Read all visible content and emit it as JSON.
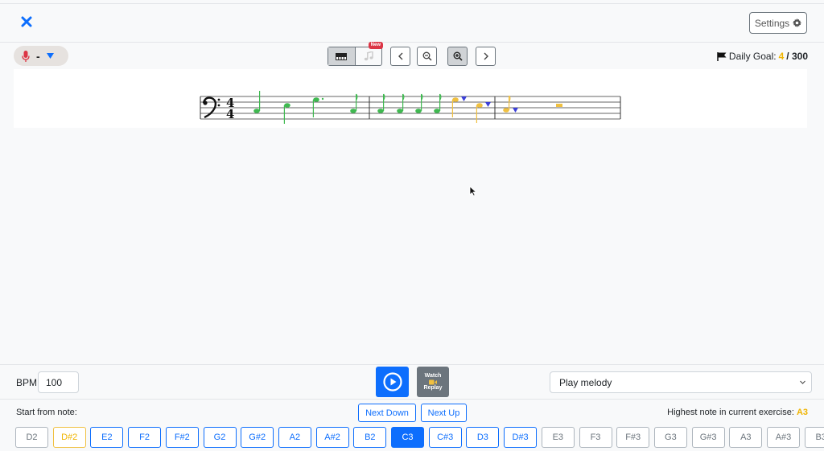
{
  "toolbar": {
    "settings_label": "Settings",
    "mic_value": "-",
    "new_badge": "New",
    "daily_goal_label": "Daily Goal:",
    "daily_goal_current": "4",
    "daily_goal_total": "/ 300"
  },
  "colors": {
    "accent": "#0d6efd",
    "correct": "#3fb950",
    "partial": "#f0c040",
    "marker": "#3b3fd8",
    "mic": "#dc3545"
  },
  "controls": {
    "bpm_label": "BPM",
    "bpm_value": "100",
    "watch_line1": "Watch",
    "watch_line2": "Replay",
    "mode_value": "Play melody"
  },
  "notes_section": {
    "start_label": "Start from note:",
    "next_down": "Next Down",
    "next_up": "Next Up",
    "highest_label": "Highest note in current exercise:",
    "highest_value": "A3",
    "notes": [
      {
        "label": "D2",
        "state": "default"
      },
      {
        "label": "D#2",
        "state": "lowest"
      },
      {
        "label": "E2",
        "state": "range"
      },
      {
        "label": "F2",
        "state": "range"
      },
      {
        "label": "F#2",
        "state": "range"
      },
      {
        "label": "G2",
        "state": "range"
      },
      {
        "label": "G#2",
        "state": "range"
      },
      {
        "label": "A2",
        "state": "range"
      },
      {
        "label": "A#2",
        "state": "range"
      },
      {
        "label": "B2",
        "state": "range"
      },
      {
        "label": "C3",
        "state": "selected"
      },
      {
        "label": "C#3",
        "state": "range"
      },
      {
        "label": "D3",
        "state": "range"
      },
      {
        "label": "D#3",
        "state": "range"
      },
      {
        "label": "E3",
        "state": "default"
      },
      {
        "label": "F3",
        "state": "default"
      },
      {
        "label": "F#3",
        "state": "default"
      },
      {
        "label": "G3",
        "state": "default"
      },
      {
        "label": "G#3",
        "state": "default"
      },
      {
        "label": "A3",
        "state": "default"
      },
      {
        "label": "A#3",
        "state": "default"
      },
      {
        "label": "B3",
        "state": "default"
      }
    ]
  },
  "score": {
    "clef": "bass",
    "time_signature": "4/4"
  },
  "icons": [
    "close-icon",
    "gear-icon",
    "microphone-icon",
    "caret-down-icon",
    "piano-icon",
    "music-note-icon",
    "chevron-left-icon",
    "zoom-out-icon",
    "zoom-in-icon",
    "chevron-right-icon",
    "flag-icon",
    "play-icon",
    "camera-icon",
    "chevron-down-icon"
  ]
}
